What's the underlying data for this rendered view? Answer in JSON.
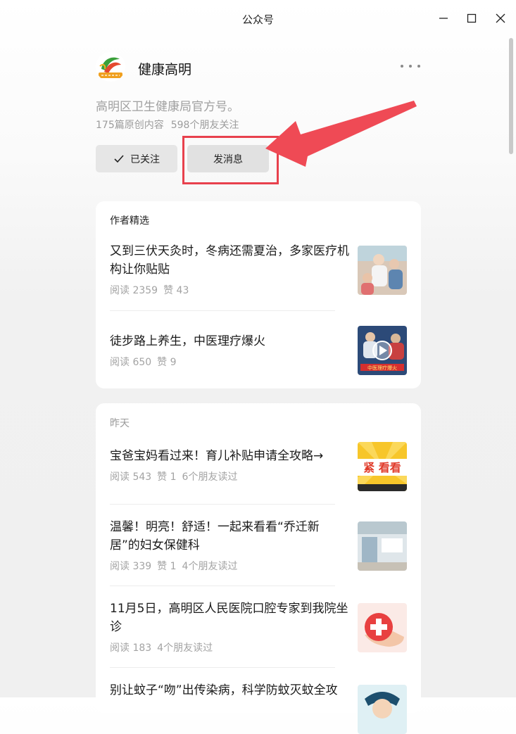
{
  "window": {
    "title": "公众号"
  },
  "account": {
    "name": "健康高明",
    "avatar_text": "健康高明",
    "description": "高明区卫生健康局官方号。",
    "original_count": "175篇原创内容",
    "friends_following": "598个朋友关注"
  },
  "actions": {
    "follow_label": "已关注",
    "message_label": "发消息"
  },
  "featured": {
    "header": "作者精选",
    "items": [
      {
        "title": "又到三伏天灸时，冬病还需夏治，多家医疗机构让你贴贴",
        "reads": "阅读 2359",
        "likes": "赞 43"
      },
      {
        "title": "徒步路上养生，中医理疗爆火",
        "reads": "阅读 650",
        "likes": "赞 9",
        "thumb_caption": "中医理疗爆火"
      }
    ]
  },
  "yesterday": {
    "header": "昨天",
    "items": [
      {
        "title": "宝爸宝妈看过来！育儿补贴申请全攻略→",
        "reads": "阅读 543",
        "likes": "赞 1",
        "friends": "6个朋友读过",
        "thumb_text": "紧 看看"
      },
      {
        "title": "温馨！明亮！舒适！一起来看看“乔迁新居”的妇女保健科",
        "reads": "阅读 339",
        "likes": "赞 1",
        "friends": "4个朋友读过"
      },
      {
        "title": "11月5日，高明区人民医院口腔专家到我院坐诊",
        "reads": "阅读 183",
        "friends": "4个朋友读过"
      },
      {
        "title": "别让蚊子“吻”出传染病，科学防蚊灭蚊全攻"
      }
    ]
  },
  "colors": {
    "highlight": "#e8414d",
    "arrow": "#ef4a55"
  }
}
